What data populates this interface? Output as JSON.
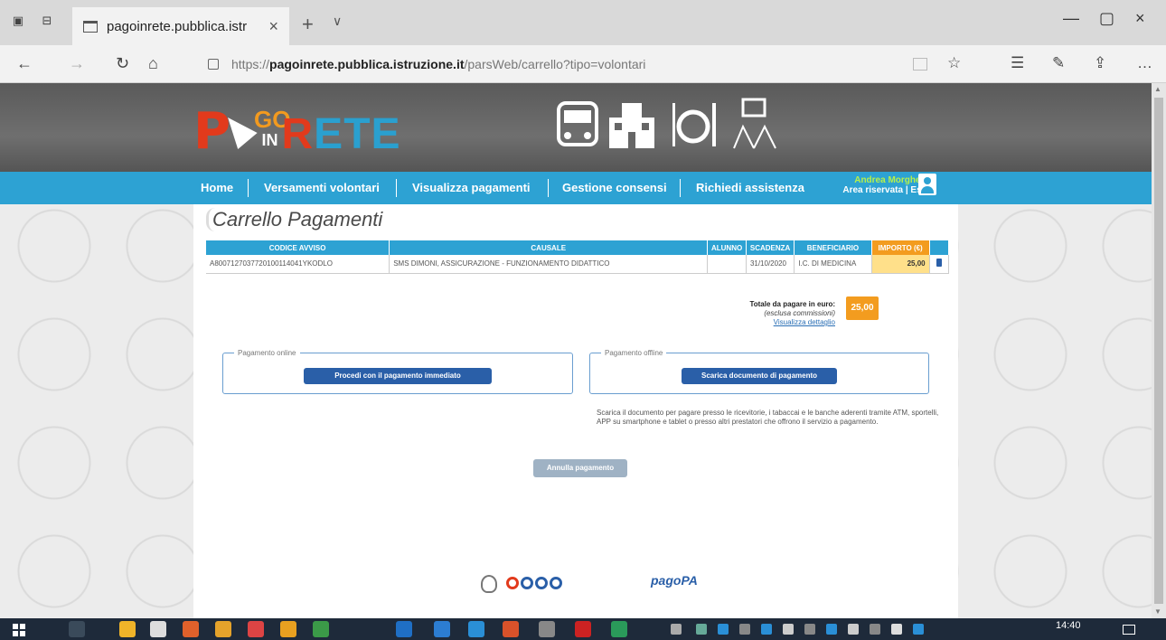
{
  "browser": {
    "tab_title": "pagoinrete.pubblica.istr",
    "url_prefix": "https://",
    "url_host": "pagoinrete.pubblica.istruzione.it",
    "url_path": "/parsWeb/carrello?tipo=volontari"
  },
  "header": {
    "logo_p": "P",
    "logo_go": "GO",
    "logo_in": "IN",
    "logo_r": "R",
    "logo_ete": "ETE"
  },
  "menu": {
    "items": [
      "Home",
      "Versamenti volontari",
      "Visualizza pagamenti",
      "Gestione consensi",
      "Richiedi assistenza"
    ],
    "user_name": "Andrea Morghetti",
    "user_links": "Area riservata | Esci"
  },
  "page": {
    "title": "Carrello Pagamenti"
  },
  "table": {
    "headers": [
      "CODICE AVVISO",
      "CAUSALE",
      "ALUNNO",
      "SCADENZA",
      "BENEFICIARIO",
      "IMPORTO (€)",
      ""
    ],
    "rows": [
      {
        "codice": "A8007127037720100114041YKODLO",
        "causale": "SMS DIMONI, ASSICURAZIONE - FUNZIONAMENTO DIDATTICO",
        "alunno": "",
        "scadenza": "31/10/2020",
        "beneficiario": "I.C. DI MEDICINA",
        "importo": "25,00"
      }
    ]
  },
  "totals": {
    "label": "Totale da pagare in euro:",
    "sublabel": "(esclusa commissioni)",
    "link": "Visualizza dettaglio",
    "amount": "25,00"
  },
  "online": {
    "legend": "Pagamento online",
    "button": "Procedi con il pagamento immediato"
  },
  "offline": {
    "legend": "Pagamento offline",
    "button": "Scarica documento di pagamento",
    "note": "Scarica il documento per pagare presso le ricevitorie, i tabaccai e le banche aderenti tramite ATM, sportelli, APP su smartphone e tablet o presso altri prestatori che offrono il servizio a pagamento."
  },
  "cancel_button": "Annulla pagamento",
  "footer": {
    "pagopa": "pagoPA"
  },
  "taskbar": {
    "time": "14:40"
  }
}
